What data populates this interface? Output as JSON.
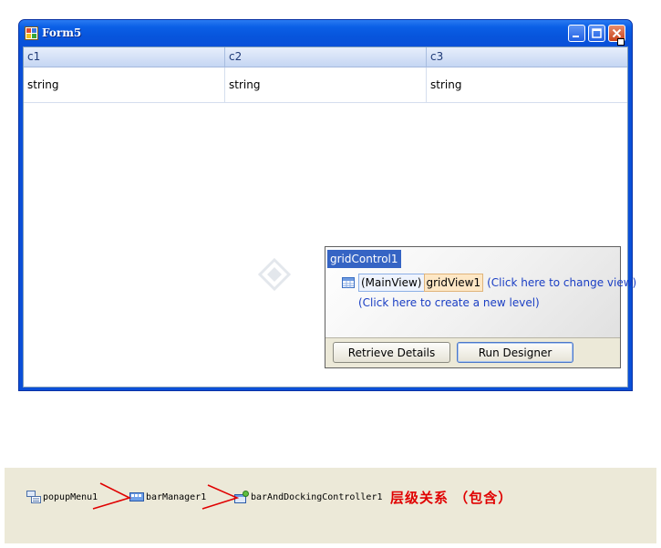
{
  "window": {
    "title": "Form5"
  },
  "grid": {
    "columns": [
      "c1",
      "c2",
      "c3"
    ],
    "rows": [
      [
        "string",
        "string",
        "string"
      ]
    ]
  },
  "level_designer": {
    "control_name": "gridControl1",
    "main_view_label": "(MainView)",
    "view_name": "gridView1",
    "change_view_link": "(Click here to change view)",
    "new_level_link": "(Click here to create a new level)",
    "retrieve_button": "Retrieve Details",
    "designer_button": "Run Designer"
  },
  "component_tray": {
    "items": [
      "popupMenu1",
      "barManager1",
      "barAndDockingController1"
    ],
    "note": "层级关系 （包含）"
  },
  "colors": {
    "title_bar": "#0a4fd8",
    "link": "#1a3ec4",
    "annotation": "#e00000",
    "tray_background": "#ece9d8"
  }
}
